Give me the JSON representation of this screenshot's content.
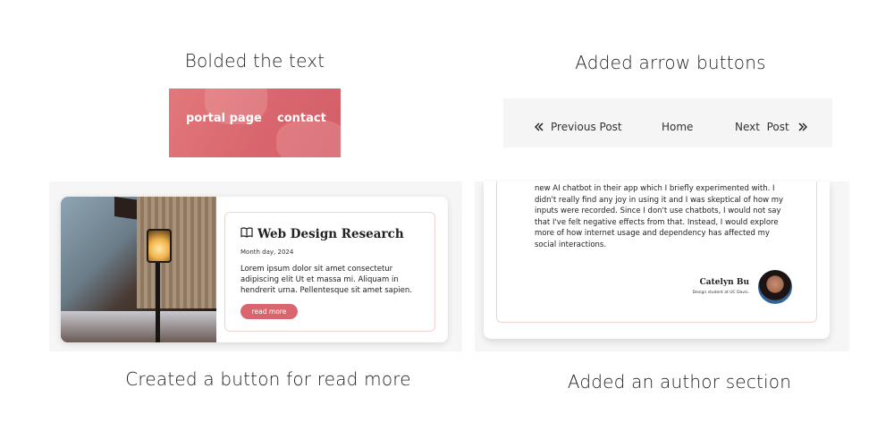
{
  "captions": {
    "bolded": "Bolded the text",
    "arrows": "Added arrow buttons",
    "read_more_button": "Created a button for read more",
    "author_section": "Added an author section"
  },
  "nav": {
    "links": [
      "portal page",
      "contact"
    ],
    "background_color": "#d9666e"
  },
  "post_nav": {
    "previous": "Previous Post",
    "home": "Home",
    "next": "Next  Post",
    "prev_icon": "double-chevron-left-icon",
    "next_icon": "double-chevron-right-icon"
  },
  "blog_card": {
    "icon": "open-book-icon",
    "title": "Web Design Research",
    "date": "Month day, 2024",
    "body": "Lorem ipsum dolor sit amet consectetur adipiscing elit Ut et massa mi. Aliquam in hendrerit urna. Pellentesque sit amet sapien.",
    "button_label": "read more",
    "accent_color": "#d9666e"
  },
  "author_card": {
    "text": "new AI chatbot in their app which I briefly experimented with. I didn't really find any joy in using it and I was skeptical of how my inputs were recorded. Since I don't use chatbots, I would not say that I've felt negative effects from that. Instead, I would explore more of how internet usage and dependency has affected my social interactions.",
    "author_name": "Catelyn Bu",
    "author_role": "Design student at UC Davis."
  }
}
